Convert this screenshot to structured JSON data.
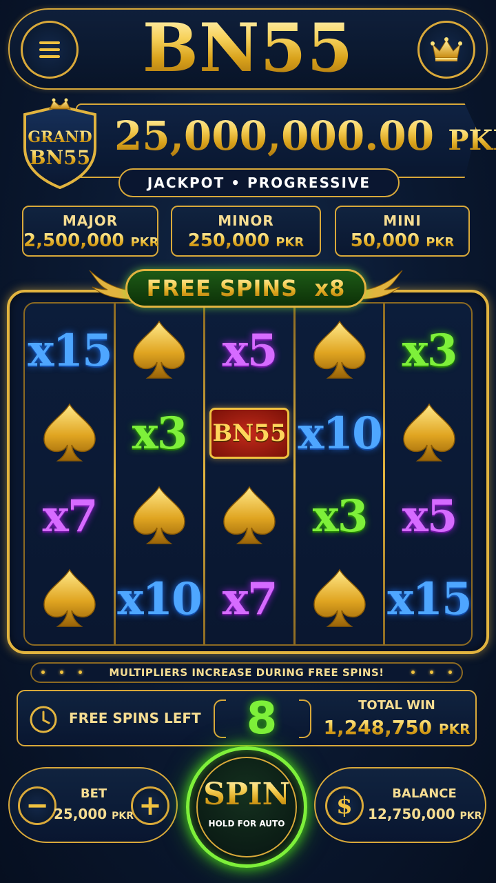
{
  "header": {
    "title": "BN55",
    "menu_icon": "hamburger-menu-icon",
    "crown_icon": "crown-icon"
  },
  "grand": {
    "badge_line1": "GRAND",
    "badge_line2": "BN55",
    "amount": "25,000,000.00",
    "currency": "PKR",
    "subtitle": "JACKPOT • PROGRESSIVE"
  },
  "jackpots": [
    {
      "label": "MAJOR",
      "amount": "2,500,000",
      "currency": "PKR"
    },
    {
      "label": "MINOR",
      "amount": "250,000",
      "currency": "PKR"
    },
    {
      "label": "MINI",
      "amount": "50,000",
      "currency": "PKR"
    }
  ],
  "free_spins_banner": "FREE SPINS  x8",
  "reels": [
    [
      {
        "type": "mult",
        "value": "x15",
        "color": "blue"
      },
      {
        "type": "spade"
      },
      {
        "type": "mult",
        "value": "x7",
        "color": "purple"
      },
      {
        "type": "spade"
      }
    ],
    [
      {
        "type": "spade"
      },
      {
        "type": "mult",
        "value": "x3",
        "color": "green"
      },
      {
        "type": "spade"
      },
      {
        "type": "mult",
        "value": "x10",
        "color": "blue"
      }
    ],
    [
      {
        "type": "mult",
        "value": "x5",
        "color": "purple"
      },
      {
        "type": "bn",
        "value": "BN55"
      },
      {
        "type": "spade"
      },
      {
        "type": "mult",
        "value": "x7",
        "color": "purple"
      }
    ],
    [
      {
        "type": "spade"
      },
      {
        "type": "mult",
        "value": "x10",
        "color": "blue"
      },
      {
        "type": "mult",
        "value": "x3",
        "color": "green"
      },
      {
        "type": "spade"
      }
    ],
    [
      {
        "type": "mult",
        "value": "x3",
        "color": "green"
      },
      {
        "type": "spade"
      },
      {
        "type": "mult",
        "value": "x5",
        "color": "purple"
      },
      {
        "type": "mult",
        "value": "x15",
        "color": "blue"
      }
    ]
  ],
  "info_text": "MULTIPLIERS INCREASE DURING FREE SPINS!",
  "status": {
    "free_spins_label": "FREE SPINS LEFT",
    "free_spins_count": "8",
    "total_win_label": "TOTAL WIN",
    "total_win_amount": "1,248,750",
    "currency": "PKR"
  },
  "bet": {
    "label": "BET",
    "amount": "25,000",
    "currency": "PKR",
    "minus": "−",
    "plus": "+"
  },
  "spin": {
    "label": "SPIN",
    "sub": "HOLD FOR AUTO"
  },
  "balance": {
    "label": "BALANCE",
    "amount": "12,750,000",
    "currency": "PKR",
    "icon_glyph": "$"
  },
  "colors": {
    "gold": "#d9a93a",
    "navy": "#0b1a33",
    "green_glow": "#7ef03a",
    "blue_mult": "#4ea6ff",
    "purple_mult": "#d66bff",
    "green_mult": "#7ef03a"
  }
}
